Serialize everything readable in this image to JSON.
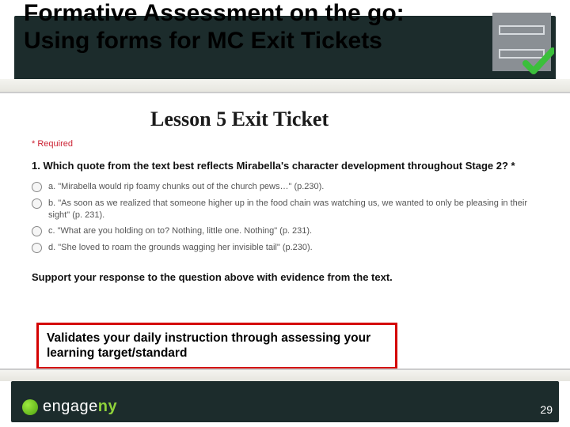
{
  "title_line1": "Formative Assessment on the go:",
  "title_line2": "Using forms for MC Exit Tickets",
  "form": {
    "heading": "Lesson 5 Exit Ticket",
    "required": "* Required",
    "question": "1. Which quote from the text best reflects Mirabella's character development throughout Stage 2? *",
    "options": [
      "a. \"Mirabella would rip foamy chunks out of the church pews…\" (p.230).",
      "b. \"As soon as we realized that someone higher up in the food chain was watching us, we wanted to only be pleasing in their sight\" (p. 231).",
      "c. \"What are you holding on to? Nothing, little one. Nothing\" (p. 231).",
      "d. \"She loved to roam the grounds wagging her invisible tail\" (p.230)."
    ],
    "support": "Support your response to the question above with evidence from the text."
  },
  "callout": "Validates your daily instruction through assessing your learning target/standard",
  "logo_text_a": "engage",
  "logo_text_b": "ny",
  "page_number": "29"
}
